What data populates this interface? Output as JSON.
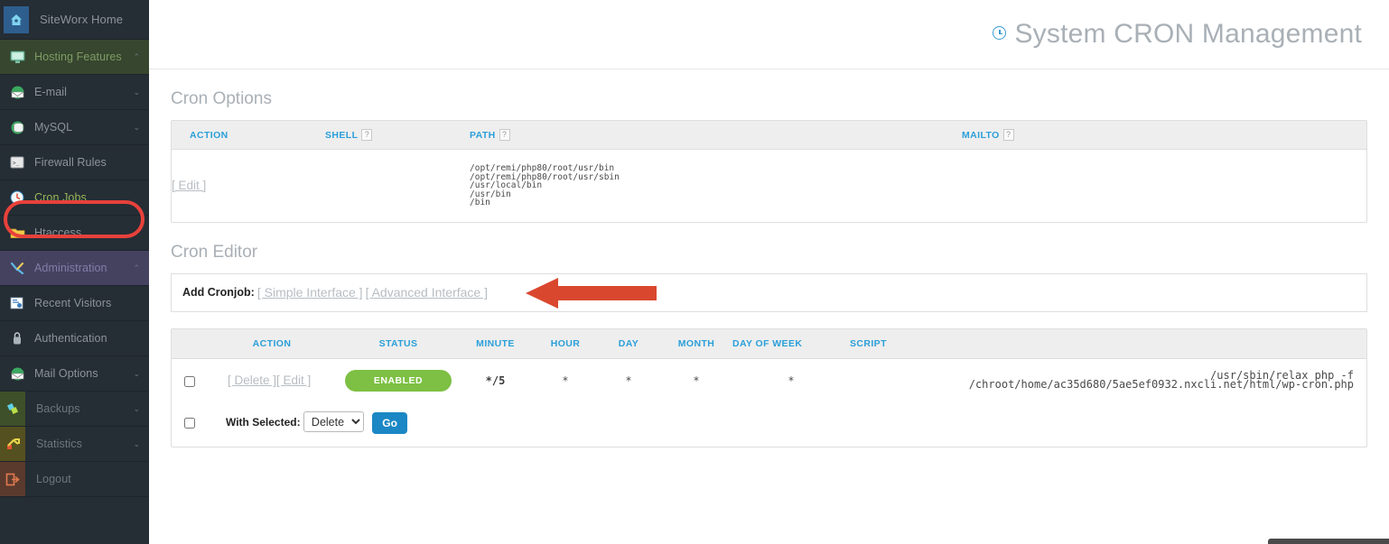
{
  "sidebar": {
    "items": [
      {
        "label": "SiteWorx Home",
        "icon": "home-icon",
        "caret": "",
        "state": "home"
      },
      {
        "label": "Hosting Features",
        "icon": "monitor-icon",
        "caret": "⌃",
        "state": "hosting"
      },
      {
        "label": "E-mail",
        "icon": "email-icon",
        "caret": "⌄",
        "state": "normal"
      },
      {
        "label": "MySQL",
        "icon": "database-icon",
        "caret": "⌄",
        "state": "normal"
      },
      {
        "label": "Firewall Rules",
        "icon": "terminal-icon",
        "caret": "",
        "state": "normal"
      },
      {
        "label": "Cron Jobs",
        "icon": "clock-icon",
        "caret": "",
        "state": "cronjobs"
      },
      {
        "label": "Htaccess",
        "icon": "folder-icon",
        "caret": "",
        "state": "normal"
      },
      {
        "label": "Administration",
        "icon": "tools-icon",
        "caret": "⌃",
        "state": "admin"
      },
      {
        "label": "Recent Visitors",
        "icon": "visitors-icon",
        "caret": "",
        "state": "normal"
      },
      {
        "label": "Authentication",
        "icon": "lock-icon",
        "caret": "",
        "state": "normal"
      },
      {
        "label": "Mail Options",
        "icon": "mailopts-icon",
        "caret": "⌄",
        "state": "normal"
      },
      {
        "label": "Backups",
        "icon": "backups-icon",
        "caret": "⌄",
        "state": "backups"
      },
      {
        "label": "Statistics",
        "icon": "statistics-icon",
        "caret": "⌄",
        "state": "stats"
      },
      {
        "label": "Logout",
        "icon": "logout-icon",
        "caret": "",
        "state": "logout"
      }
    ]
  },
  "header": {
    "title": "System CRON Management",
    "icon": "clock-icon"
  },
  "cron_options": {
    "section_title": "Cron Options",
    "columns": [
      "ACTION",
      "SHELL",
      "PATH",
      "MAILTO"
    ],
    "help_marker": "?",
    "row": {
      "action": "[ Edit ]",
      "shell": "",
      "path": "/opt/remi/php80/root/usr/bin\n/opt/remi/php80/root/usr/sbin\n/usr/local/bin\n/usr/bin\n/bin",
      "mailto": ""
    }
  },
  "cron_editor": {
    "section_title": "Cron Editor",
    "add_label": "Add Cronjob:",
    "simple_interface": "[ Simple Interface ]",
    "advanced_interface": "[ Advanced Interface ]"
  },
  "jobs_table": {
    "columns": [
      "",
      "ACTION",
      "STATUS",
      "MINUTE",
      "HOUR",
      "DAY",
      "MONTH",
      "DAY OF WEEK",
      "SCRIPT"
    ],
    "rows": [
      {
        "checked": false,
        "delete_label": "[ Delete ]",
        "edit_label": "[ Edit ]",
        "status": "ENABLED",
        "minute": "*/5",
        "hour": "*",
        "day": "*",
        "month": "*",
        "day_of_week": "*",
        "script": "/usr/sbin/relax php -f\n/chroot/home/ac35d680/5ae5ef0932.nxcli.net/html/wp-cron.php"
      }
    ],
    "footer": {
      "with_selected_label": "With Selected:",
      "select_value": "Delete",
      "select_options": [
        "Delete"
      ],
      "go_label": "Go"
    }
  },
  "colors": {
    "sidebar_bg": "#252d35",
    "accent_blue": "#2b9fd9",
    "enabled_green": "#7dc043",
    "go_blue": "#1b87c4",
    "annotation_red": "#d9472f",
    "oval_red": "#e8413a"
  }
}
